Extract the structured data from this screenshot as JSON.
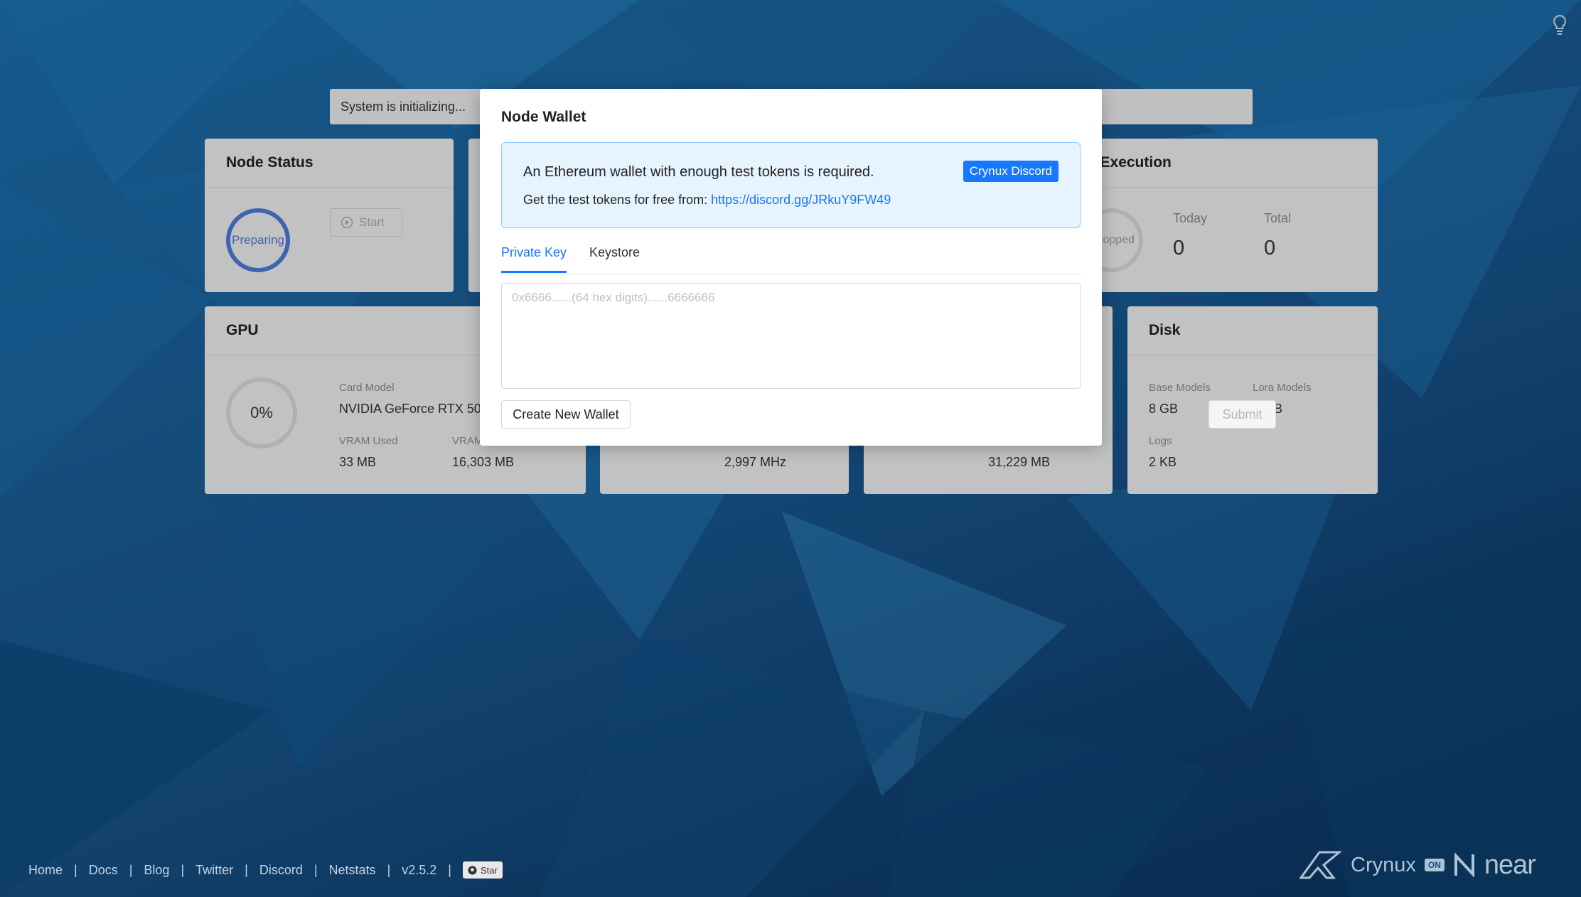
{
  "background": {
    "base_color": "#17548a"
  },
  "status_bar": {
    "text": "System is initializing..."
  },
  "node_status": {
    "title": "Node Status",
    "ring_label": "Preparing",
    "start_label": "Start"
  },
  "task_execution": {
    "title_partial": "k Execution",
    "ring_label_partial": "opped",
    "today_label": "Today",
    "today_value": "0",
    "total_label": "Total",
    "total_value": "0"
  },
  "gpu": {
    "title": "GPU",
    "usage": "0%",
    "card_model_label": "Card Model",
    "card_model_value": "NVIDIA GeForce RTX 5080",
    "vram_used_label": "VRAM Used",
    "vram_used_value": "33 MB",
    "vram_total_label": "VRAM",
    "vram_total_value": "16,303 MB"
  },
  "cpu": {
    "freq_value": "2,997 MHz"
  },
  "memory": {
    "value": "31,229 MB"
  },
  "disk": {
    "title": "Disk",
    "base_models_label": "Base Models",
    "base_models_value": "8 GB",
    "lora_models_label": "Lora Models",
    "lora_models_value": "0 MB",
    "logs_label": "Logs",
    "logs_value": "2 KB"
  },
  "modal": {
    "title": "Node Wallet",
    "alert_line1": "An Ethereum wallet with enough test tokens is required.",
    "alert_line2_prefix": "Get the test tokens for free from: ",
    "alert_link": "https://discord.gg/JRkuY9FW49",
    "discord_button": "Crynux Discord",
    "tabs": [
      {
        "label": "Private Key",
        "active": true
      },
      {
        "label": "Keystore",
        "active": false
      }
    ],
    "private_key_value": "",
    "private_key_placeholder": "0x6666......(64 hex digits)......6666666",
    "create_button": "Create New Wallet",
    "submit_button": "Submit"
  },
  "footer": {
    "links": [
      "Home",
      "Docs",
      "Blog",
      "Twitter",
      "Discord",
      "Netstats",
      "v2.5.2"
    ],
    "star_label": "Star"
  },
  "branding": {
    "crynux": "Crynux",
    "on": "ON",
    "near": "near"
  },
  "colors": {
    "accent": "#1677ff",
    "ring": "#4d7bd6",
    "alert_bg": "#e6f4ff"
  }
}
